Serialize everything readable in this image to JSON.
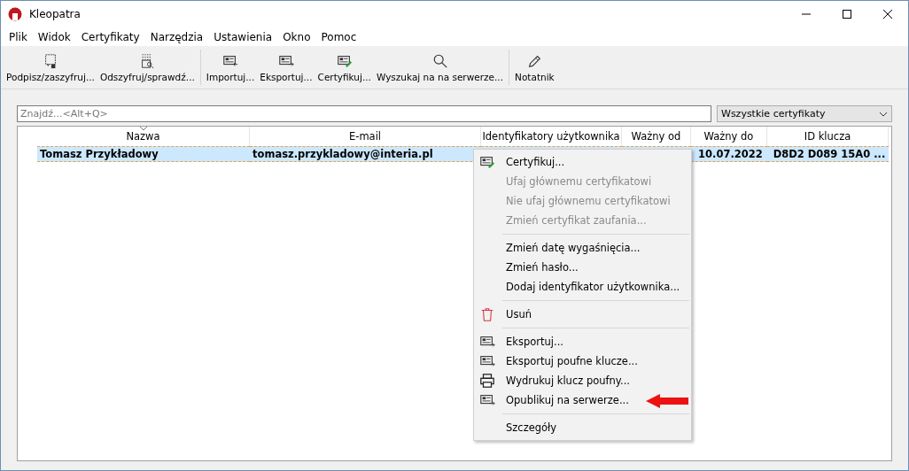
{
  "window": {
    "title": "Kleopatra"
  },
  "menu_bar": [
    "Plik",
    "Widok",
    "Certyfikaty",
    "Narzędzia",
    "Ustawienia",
    "Okno",
    "Pomoc"
  ],
  "toolbar_groups": [
    [
      {
        "label": "Podpisz/zaszyfruj...",
        "kind": "sign"
      },
      {
        "label": "Odszyfruj/sprawdź...",
        "kind": "decrypt"
      }
    ],
    [
      {
        "label": "Importuj...",
        "kind": "import"
      },
      {
        "label": "Eksportuj...",
        "kind": "export"
      },
      {
        "label": "Certyfikuj...",
        "kind": "certify"
      },
      {
        "label": "Wyszukaj na na serwerze...",
        "kind": "search"
      }
    ],
    [
      {
        "label": "Notatnik",
        "kind": "pencil"
      }
    ]
  ],
  "search": {
    "placeholder": "Znajdź...<Alt+Q>"
  },
  "filter": {
    "value": "Wszystkie certyfikaty"
  },
  "table": {
    "columns": [
      {
        "label": "Nazwa",
        "sorted": true
      },
      {
        "label": "E-mail",
        "sorted": false
      },
      {
        "label": "Identyfikatory użytkownika",
        "sorted": false
      },
      {
        "label": "Ważny od",
        "sorted": false
      },
      {
        "label": "Ważny do",
        "sorted": false
      },
      {
        "label": "ID klucza",
        "sorted": false
      }
    ],
    "rows": [
      {
        "selected": true,
        "cells": [
          "Tomasz Przykładowy",
          "tomasz.przykladowy@interia.pl",
          null,
          null,
          "10.07.2022",
          "D8D2 D089 15A0 ..."
        ]
      }
    ]
  },
  "context_menu": [
    {
      "kind": "certify",
      "label": "Certyfikuj...",
      "disabled": false,
      "highlighted": false
    },
    {
      "kind": "plain",
      "label": "Ufaj głównemu certyfikatowi",
      "disabled": true,
      "highlighted": false
    },
    {
      "kind": "plain",
      "label": "Nie ufaj głównemu certyfikatowi",
      "disabled": true,
      "highlighted": false
    },
    {
      "kind": "plain",
      "label": "Zmień certyfikat zaufania...",
      "disabled": true,
      "highlighted": false
    },
    {
      "kind": "separator"
    },
    {
      "kind": "plain",
      "label": "Zmień datę wygaśnięcia...",
      "disabled": false,
      "highlighted": false
    },
    {
      "kind": "plain",
      "label": "Zmień hasło...",
      "disabled": false,
      "highlighted": false
    },
    {
      "kind": "plain",
      "label": "Dodaj identyfikator użytkownika...",
      "disabled": false,
      "highlighted": false
    },
    {
      "kind": "separator"
    },
    {
      "kind": "trash",
      "label": "Usuń",
      "disabled": false,
      "highlighted": false
    },
    {
      "kind": "separator"
    },
    {
      "kind": "export",
      "label": "Eksportuj...",
      "disabled": false,
      "highlighted": false
    },
    {
      "kind": "export",
      "label": "Eksportuj poufne klucze...",
      "disabled": false,
      "highlighted": false
    },
    {
      "kind": "printer",
      "label": "Wydrukuj klucz poufny...",
      "disabled": false,
      "highlighted": false
    },
    {
      "kind": "publish",
      "label": "Opublikuj na serwerze...",
      "disabled": false,
      "highlighted": true
    },
    {
      "kind": "separator"
    },
    {
      "kind": "plain",
      "label": "Szczegóły",
      "disabled": false,
      "highlighted": false
    }
  ]
}
